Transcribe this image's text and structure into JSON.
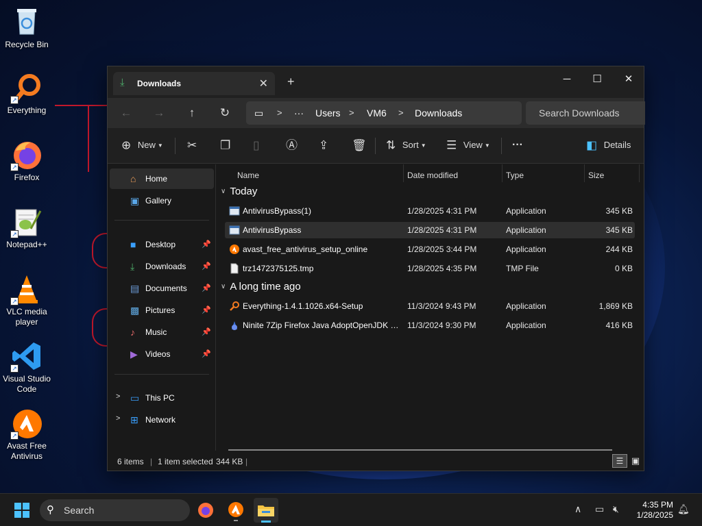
{
  "desktop": {
    "icons": [
      {
        "label": "Recycle Bin"
      },
      {
        "label": "Everything"
      },
      {
        "label": "Firefox"
      },
      {
        "label": "Notepad++"
      },
      {
        "label": "VLC media player"
      },
      {
        "label": "Visual Studio Code"
      },
      {
        "label": "Avast Free Antivirus"
      }
    ]
  },
  "window": {
    "tab_title": "Downloads",
    "new_tab": "+",
    "controls": {
      "minimize": "─",
      "maximize": "☐",
      "close": "✕"
    },
    "breadcrumb": [
      "Users",
      "VM6",
      "Downloads"
    ],
    "breadcrumb_more": "···",
    "search_placeholder": "Search Downloads",
    "toolbar": {
      "new_label": "New",
      "sort_label": "Sort",
      "view_label": "View",
      "more_label": "···",
      "details_label": "Details"
    },
    "sidebar": {
      "home": "Home",
      "gallery": "Gallery",
      "quick": [
        "Desktop",
        "Downloads",
        "Documents",
        "Pictures",
        "Music",
        "Videos"
      ],
      "this_pc": "This PC",
      "network": "Network"
    },
    "columns": {
      "name": "Name",
      "date": "Date modified",
      "type": "Type",
      "size": "Size"
    },
    "groups": {
      "today": {
        "label": "Today",
        "files": [
          {
            "name": "AntivirusBypass(1)",
            "date": "1/28/2025 4:31 PM",
            "type": "Application",
            "size": "345 KB"
          },
          {
            "name": "AntivirusBypass",
            "date": "1/28/2025 4:31 PM",
            "type": "Application",
            "size": "345 KB"
          },
          {
            "name": "avast_free_antivirus_setup_online",
            "date": "1/28/2025 3:44 PM",
            "type": "Application",
            "size": "244 KB"
          },
          {
            "name": "trz1472375125.tmp",
            "date": "1/28/2025 4:35 PM",
            "type": "TMP File",
            "size": "0 KB"
          }
        ]
      },
      "older": {
        "label": "A long time ago",
        "files": [
          {
            "name": "Everything-1.4.1.1026.x64-Setup",
            "date": "11/3/2024 9:43 PM",
            "type": "Application",
            "size": "1,869 KB"
          },
          {
            "name": "Ninite 7Zip Firefox Java AdoptOpenJDK x...",
            "date": "11/3/2024 9:30 PM",
            "type": "Application",
            "size": "416 KB"
          }
        ]
      }
    },
    "status": {
      "items": "6 items",
      "selected": "1 item selected",
      "size": "344 KB",
      "divider": "|"
    }
  },
  "taskbar": {
    "search_label": "Search",
    "time": "4:35 PM",
    "date": "1/28/2025"
  },
  "colors": {
    "accent": "#4cc2ff",
    "folder_yellow": "#f4c342",
    "background": "#0a1a45"
  }
}
